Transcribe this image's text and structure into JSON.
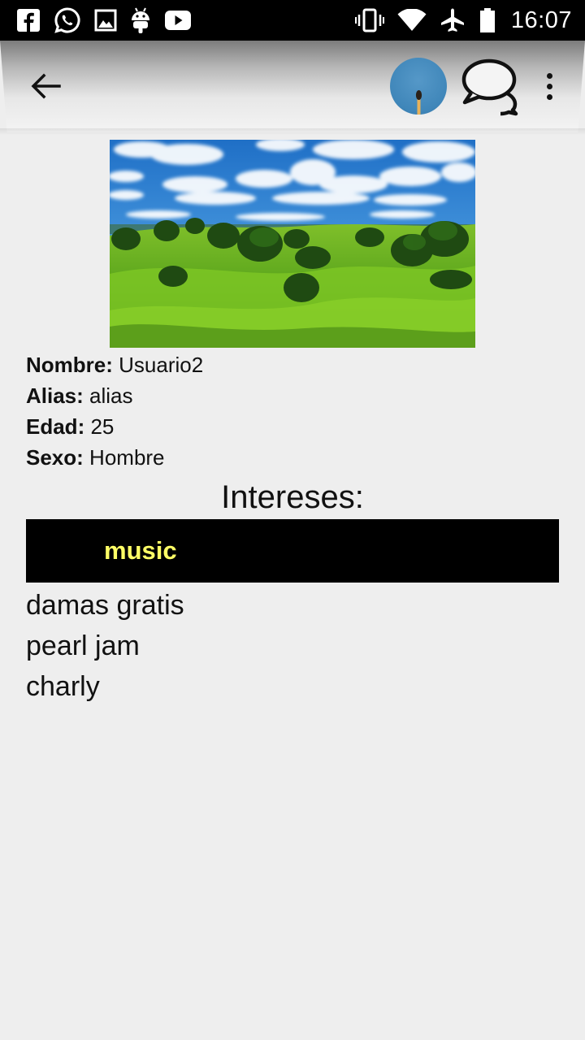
{
  "status_bar": {
    "time": "16:07",
    "left_icons": [
      "facebook-icon",
      "whatsapp-icon",
      "gallery-icon",
      "android-icon",
      "youtube-icon"
    ],
    "right_icons": [
      "vibrate-icon",
      "wifi-icon",
      "airplane-mode-icon",
      "battery-icon"
    ]
  },
  "app_bar": {
    "actions": [
      "back-arrow-icon",
      "avatar",
      "chat-bubbles-icon",
      "overflow-menu-icon"
    ]
  },
  "profile": {
    "photo": "landscape",
    "fields": [
      {
        "label": "Nombre:",
        "value": "Usuario2"
      },
      {
        "label": "Alias:",
        "value": "alias"
      },
      {
        "label": "Edad:",
        "value": "25"
      },
      {
        "label": "Sexo:",
        "value": "Hombre"
      }
    ]
  },
  "interests": {
    "title": "Intereses:",
    "highlighted": "music",
    "items": [
      "damas gratis",
      "pearl jam",
      "charly"
    ]
  },
  "colors": {
    "background": "#eeeeee",
    "status_bar": "#000000",
    "highlight_bg": "#000000",
    "highlight_text": "#ffff66",
    "avatar": "#3f86b9"
  }
}
